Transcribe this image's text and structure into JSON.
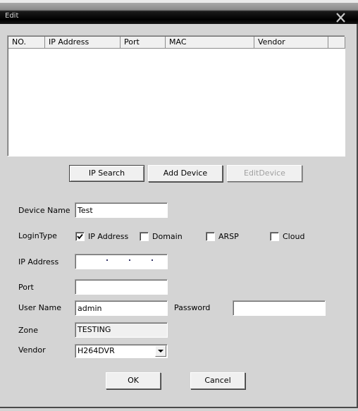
{
  "window": {
    "title": "Edit",
    "close_icon": "close-x-icon"
  },
  "device_list": {
    "columns": [
      "NO.",
      "IP Address",
      "Port",
      "MAC",
      "Vendor",
      ""
    ],
    "rows": []
  },
  "list_buttons": {
    "ip_search": "IP Search",
    "add_device": "Add Device",
    "edit_device": "EditDevice"
  },
  "form": {
    "device_name": {
      "label": "Device Name",
      "value": "Test"
    },
    "login_type": {
      "label": "LoginType",
      "options": [
        {
          "label": "IP Address",
          "checked": true
        },
        {
          "label": "Domain",
          "checked": false
        },
        {
          "label": "ARSP",
          "checked": false
        },
        {
          "label": "Cloud",
          "checked": false
        }
      ]
    },
    "ip_address": {
      "label": "IP Address",
      "value": ". . ."
    },
    "port": {
      "label": "Port",
      "value": ""
    },
    "user_name": {
      "label": "User Name",
      "value": "admin"
    },
    "password": {
      "label": "Password",
      "value": ""
    },
    "zone": {
      "label": "Zone",
      "value": "TESTING"
    },
    "vendor": {
      "label": "Vendor",
      "value": "H264DVR"
    }
  },
  "footer": {
    "ok": "OK",
    "cancel": "Cancel"
  }
}
